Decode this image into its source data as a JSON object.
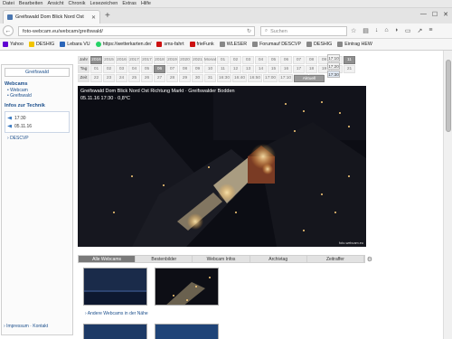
{
  "menubar": {
    "items": [
      "Datei",
      "Bearbeiten",
      "Ansicht",
      "Chronik",
      "Lesezeichen",
      "Extras",
      "Hilfe"
    ]
  },
  "tab": {
    "title": "Greifswald Dom Blick Nord Ost"
  },
  "nav": {
    "url": "foto-webcam.eu/webcam/greifswald/",
    "search_placeholder": "Suchen"
  },
  "bookmarks": [
    {
      "label": "Yahoo",
      "color": "#6001d2"
    },
    {
      "label": "DESHIG",
      "color": "#f2c400"
    },
    {
      "label": "Lebara VU",
      "color": "#2a65b8"
    },
    {
      "label": "https://wetterkarten.de/",
      "color": "#25d366"
    },
    {
      "label": "sms-fahrt",
      "color": "#cc1111"
    },
    {
      "label": "frieFunk",
      "color": "#cc1111"
    },
    {
      "label": "WLESER",
      "color": "#666666"
    },
    {
      "label": "Forumauf DESCVP",
      "color": "#666666"
    },
    {
      "label": "DESHIG",
      "color": "#666666"
    },
    {
      "label": "Eintrag HEW",
      "color": "#666666"
    }
  ],
  "sidebar": {
    "header": "Greifswald",
    "webcams_title": "Webcams",
    "webcams_items": [
      "Webcam",
      "Greifswald"
    ],
    "info_title": "Infos zur Technik",
    "rows": [
      "17:30",
      "05.11.16"
    ],
    "link": "DESCVP",
    "footer": "Impressum · Kontakt"
  },
  "datenav": {
    "row1": {
      "label": "Jahr",
      "cells": [
        "2016",
        "2015",
        "2016",
        "2017",
        "2017",
        "2018",
        "2019",
        "2020",
        "2021",
        "Monat",
        "01",
        "02",
        "03",
        "04",
        "05",
        "06",
        "07",
        "08",
        "09",
        "10",
        "11"
      ],
      "selected": [
        0,
        20
      ]
    },
    "row2": {
      "label": "Tag",
      "cells": [
        "01",
        "02",
        "03",
        "04",
        "05",
        "06",
        "07",
        "08",
        "09",
        "10",
        "11",
        "12",
        "13",
        "14",
        "15",
        "16",
        "17",
        "18",
        "19",
        "20",
        "21"
      ],
      "selected": [
        5
      ]
    },
    "row3": {
      "label": "Zeit",
      "cells": [
        "22",
        "23",
        "24",
        "25",
        "26",
        "27",
        "28",
        "29",
        "30",
        "31",
        "16:30",
        "16:40",
        "16:50",
        "17:00",
        "17:10",
        "17:20",
        "17:30"
      ],
      "selected": []
    },
    "aktuell": "Aktuell",
    "times": [
      "17:10",
      "17:20",
      "17:30"
    ]
  },
  "cam": {
    "title": "Greifswald Dom Blick Nord Ost Richtung Markt · Greifswalder Bodden",
    "subtitle": "05.11.16 17:30 · 0,8°C",
    "credit": "foto-webcam.eu"
  },
  "content_tabs": [
    "Alle Webcams",
    "Bestenbilder",
    "Webcam Infos",
    "Archivtag",
    "Zeitraffer"
  ],
  "thumbs_caption": "Andere Webcams in der Nähe"
}
